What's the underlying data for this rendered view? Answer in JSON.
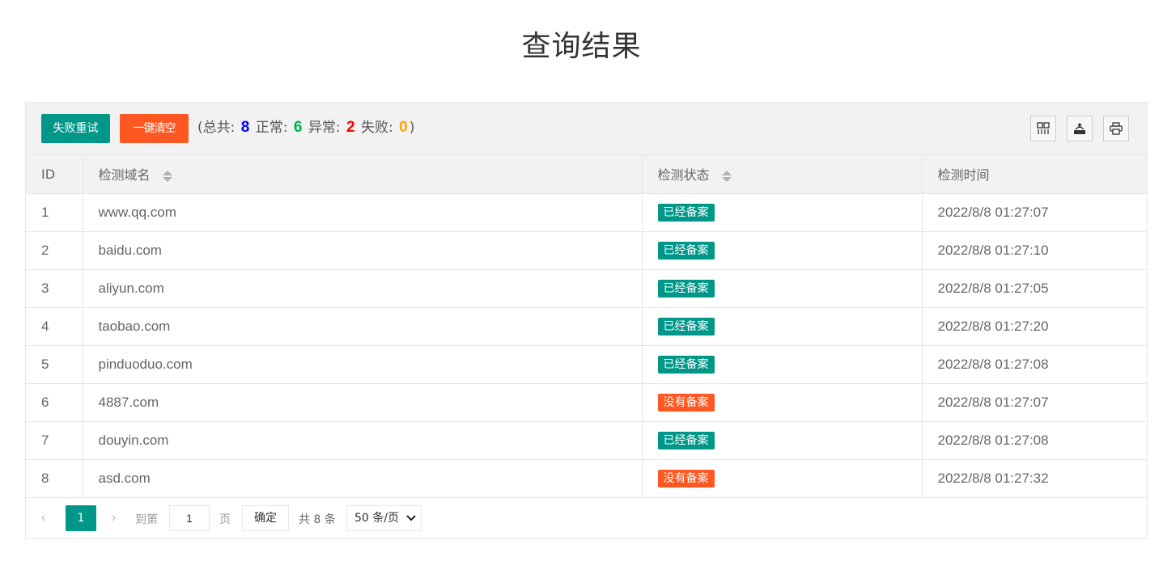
{
  "page": {
    "title": "查询结果"
  },
  "toolbar": {
    "retry_label": "失败重试",
    "clear_label": "一键清空",
    "summary": {
      "open": "(",
      "total_label": "总共:",
      "total": "8",
      "normal_label": "正常:",
      "normal": "6",
      "abnormal_label": "异常:",
      "abnormal": "2",
      "failed_label": "失败:",
      "failed": "0",
      "close": ")"
    },
    "icons": [
      "columns-icon",
      "export-icon",
      "print-icon"
    ]
  },
  "table": {
    "headers": {
      "id": "ID",
      "domain": "检测域名",
      "status": "检测状态",
      "time": "检测时间"
    },
    "rows": [
      {
        "id": "1",
        "domain": "www.qq.com",
        "status": "已经备案",
        "status_type": "ok",
        "time": "2022/8/8 01:27:07"
      },
      {
        "id": "2",
        "domain": "baidu.com",
        "status": "已经备案",
        "status_type": "ok",
        "time": "2022/8/8 01:27:10"
      },
      {
        "id": "3",
        "domain": "aliyun.com",
        "status": "已经备案",
        "status_type": "ok",
        "time": "2022/8/8 01:27:05"
      },
      {
        "id": "4",
        "domain": "taobao.com",
        "status": "已经备案",
        "status_type": "ok",
        "time": "2022/8/8 01:27:20"
      },
      {
        "id": "5",
        "domain": "pinduoduo.com",
        "status": "已经备案",
        "status_type": "ok",
        "time": "2022/8/8 01:27:08"
      },
      {
        "id": "6",
        "domain": "4887.com",
        "status": "没有备案",
        "status_type": "bad",
        "time": "2022/8/8 01:27:07"
      },
      {
        "id": "7",
        "domain": "douyin.com",
        "status": "已经备案",
        "status_type": "ok",
        "time": "2022/8/8 01:27:08"
      },
      {
        "id": "8",
        "domain": "asd.com",
        "status": "没有备案",
        "status_type": "bad",
        "time": "2022/8/8 01:27:32"
      }
    ]
  },
  "pager": {
    "prev": "‹",
    "current": "1",
    "next": "›",
    "goto_label": "到第",
    "goto_value": "1",
    "page_label": "页",
    "confirm_label": "确定",
    "total_label": "共 8 条",
    "page_size": "50 条/页"
  },
  "colors": {
    "primary": "#009688",
    "danger": "#ff5722",
    "total_num": "#0000ff",
    "normal_num": "#00b050",
    "abnormal_num": "#ff0000",
    "failed_num": "#ffa500"
  }
}
